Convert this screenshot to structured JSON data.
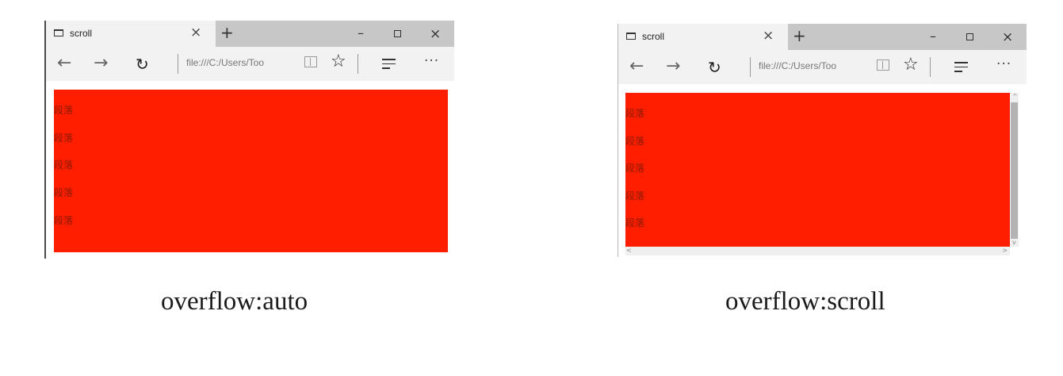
{
  "colors": {
    "content_background": "#ff1f00",
    "paragraph_text": "#8a1a00",
    "tab_active": "#f2f2f2",
    "titlebar": "#c7c7c7",
    "scrollbar_thumb": "#b3b3b3"
  },
  "icons": {
    "tab": "tab-page-icon",
    "close": "×",
    "new_tab": "+",
    "minimize": "–",
    "close_window": "×",
    "back": "←",
    "forward": "→",
    "refresh": "↻",
    "star": "☆",
    "more": "···",
    "scroll_up": "^",
    "scroll_down": "v",
    "scroll_left": "<",
    "scroll_right": ">"
  },
  "browsers": [
    {
      "tab_title": "scroll",
      "address": "file:///C:/Users/Too",
      "paragraphs": [
        "段落",
        "段落",
        "段落",
        "段落",
        "段落"
      ],
      "caption": "overflow:auto"
    },
    {
      "tab_title": "scroll",
      "address": "file:///C:/Users/Too",
      "paragraphs": [
        "段落",
        "段落",
        "段落",
        "段落",
        "段落"
      ],
      "caption": "overflow:scroll"
    }
  ]
}
